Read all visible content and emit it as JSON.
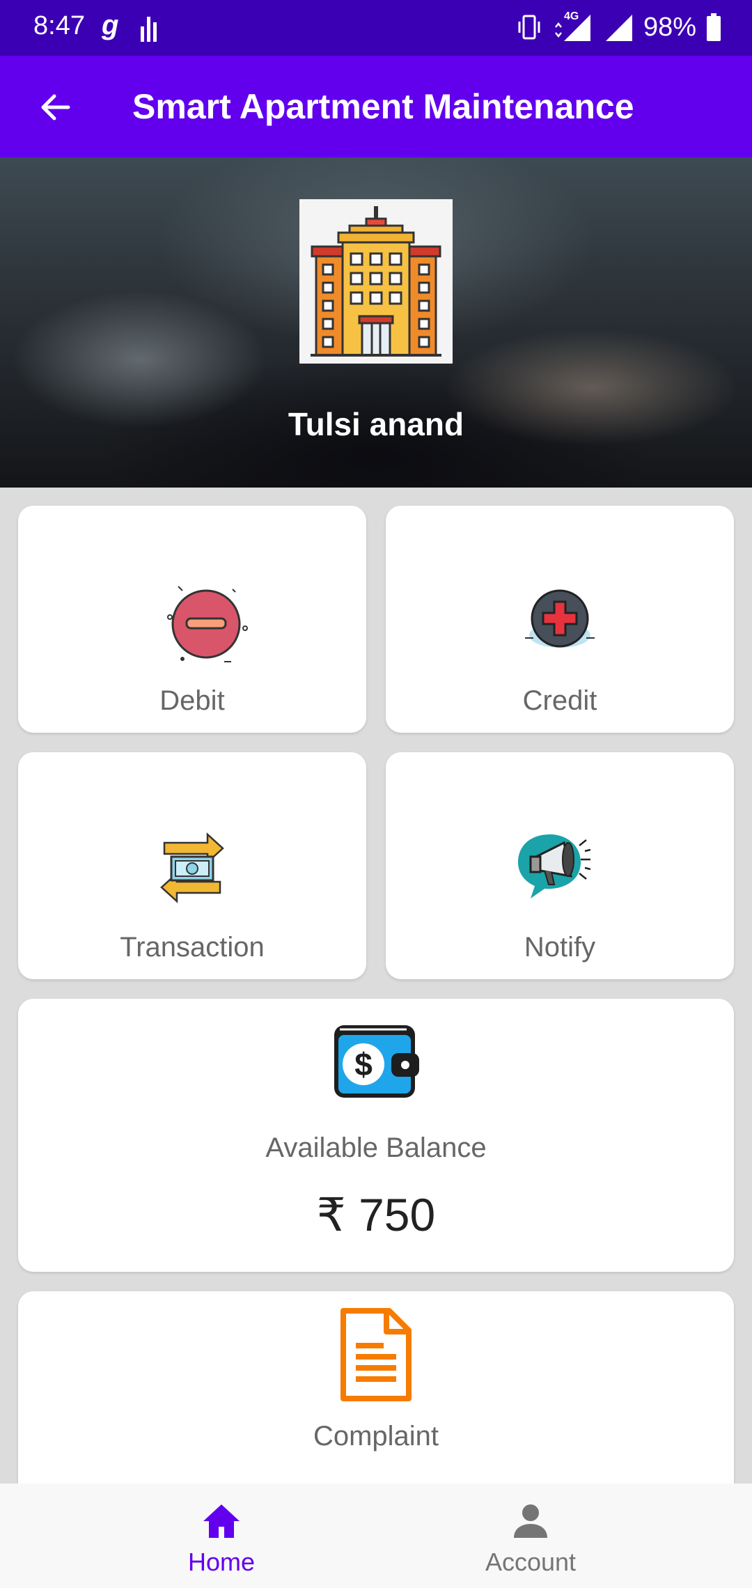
{
  "status_bar": {
    "time": "8:47",
    "carrier_glyph": "g",
    "network": "4G",
    "battery": "98%"
  },
  "app_bar": {
    "title": "Smart Apartment Maintenance",
    "back_icon": "arrow-back-icon"
  },
  "header": {
    "logo_icon": "apartment-building-icon",
    "user_name": "Tulsi anand"
  },
  "cards": {
    "debit": {
      "label": "Debit",
      "icon": "minus-circle-icon"
    },
    "credit": {
      "label": "Credit",
      "icon": "plus-circle-icon"
    },
    "transaction": {
      "label": "Transaction",
      "icon": "money-transfer-icon"
    },
    "notify": {
      "label": "Notify",
      "icon": "megaphone-icon"
    },
    "balance": {
      "label": "Available Balance",
      "amount": "₹ 750",
      "icon": "wallet-icon"
    },
    "complaint": {
      "label": "Complaint",
      "icon": "document-icon"
    }
  },
  "bottom_nav": {
    "items": [
      {
        "label": "Home",
        "icon": "home-icon",
        "active": true
      },
      {
        "label": "Account",
        "icon": "person-icon",
        "active": false
      }
    ]
  },
  "colors": {
    "status_bar": "#3c00b4",
    "primary": "#6200ee",
    "background": "#dcdcdc",
    "nav_active": "#6200ee",
    "nav_inactive": "#757575"
  }
}
